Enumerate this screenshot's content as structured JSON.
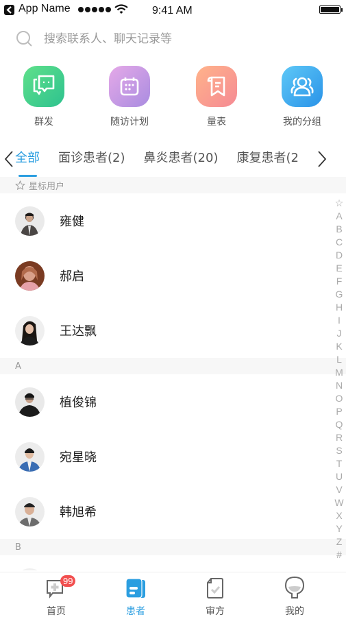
{
  "status_bar": {
    "app_name": "App Name",
    "time": "9:41 AM",
    "signal_dots": 5,
    "battery_level": 1.0
  },
  "search": {
    "placeholder": "搜索联系人、聊天记录等",
    "value": ""
  },
  "quick_actions": [
    {
      "label": "群发",
      "icon": "group-message-icon",
      "color": "#2ec28f"
    },
    {
      "label": "随访计划",
      "icon": "calendar-icon",
      "color": "#b891e2"
    },
    {
      "label": "量表",
      "icon": "scale-form-icon",
      "color": "#f7958f"
    },
    {
      "label": "我的分组",
      "icon": "group-users-icon",
      "color": "#2a93e8"
    }
  ],
  "tabs": {
    "items": [
      {
        "label": "全部",
        "active": true
      },
      {
        "label": "面诊患者(2)",
        "active": false
      },
      {
        "label": "鼻炎患者(20)",
        "active": false
      },
      {
        "label": "康复患者(2",
        "active": false
      }
    ],
    "accent": "#2b9ee0"
  },
  "sections": [
    {
      "title": "星标用户",
      "icon": "star-outline-icon",
      "contacts": [
        {
          "name": "雍健",
          "avatar": "avatar-man-dark-jacket"
        },
        {
          "name": "郝启",
          "avatar": "avatar-woman-red-bg"
        },
        {
          "name": "王达飘",
          "avatar": "avatar-woman-long-hair"
        }
      ]
    },
    {
      "title": "A",
      "contacts": [
        {
          "name": "植俊锦",
          "avatar": "avatar-man-black-shirt"
        },
        {
          "name": "宛星晓",
          "avatar": "avatar-man-blue-shirt"
        },
        {
          "name": "韩旭希",
          "avatar": "avatar-man-grey-shirt"
        }
      ]
    },
    {
      "title": "B",
      "contacts": [
        {
          "name": "",
          "avatar": "avatar-partial"
        }
      ]
    }
  ],
  "alphabet_index": [
    "☆",
    "A",
    "B",
    "C",
    "D",
    "E",
    "F",
    "G",
    "H",
    "I",
    "J",
    "K",
    "L",
    "M",
    "N",
    "O",
    "P",
    "Q",
    "R",
    "S",
    "T",
    "U",
    "V",
    "W",
    "X",
    "Y",
    "Z",
    "#"
  ],
  "tab_bar": {
    "items": [
      {
        "label": "首页",
        "icon": "home-chat-icon",
        "active": false,
        "badge": "99"
      },
      {
        "label": "患者",
        "icon": "patient-folder-icon",
        "active": true
      },
      {
        "label": "审方",
        "icon": "prescription-check-icon",
        "active": false
      },
      {
        "label": "我的",
        "icon": "profile-bulb-icon",
        "active": false
      }
    ],
    "badge_color": "#f25050"
  }
}
